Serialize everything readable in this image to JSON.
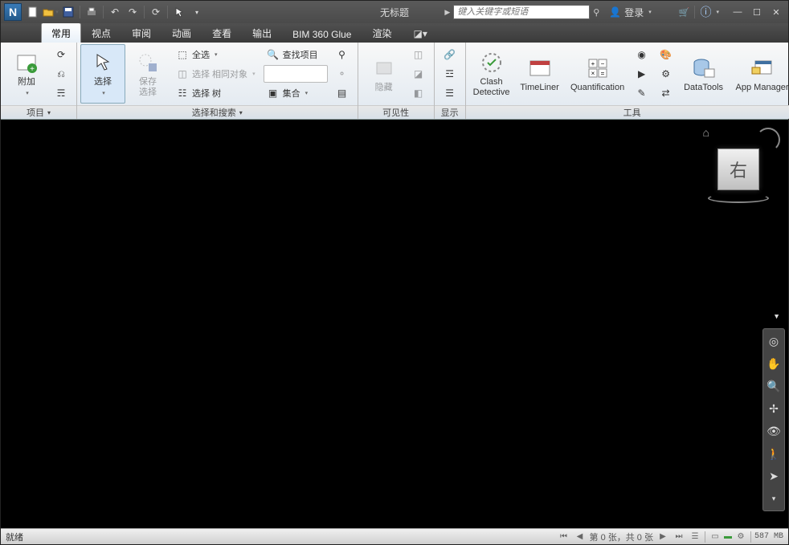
{
  "app": {
    "logo_letter": "N",
    "title": "无标题",
    "search_placeholder": "键入关键字或短语",
    "login_label": "登录"
  },
  "qat": {
    "new": "新建",
    "open": "打开",
    "save": "保存",
    "print": "打印",
    "undo": "撤销",
    "redo": "重做",
    "refresh": "刷新",
    "select": "选择"
  },
  "tabs": {
    "home": "常用",
    "viewpoint": "视点",
    "review": "审阅",
    "animation": "动画",
    "view": "查看",
    "output": "输出",
    "bim360": "BIM 360 Glue",
    "render": "渲染"
  },
  "ribbon": {
    "groups": {
      "project": "项目",
      "select_search": "选择和搜索",
      "visibility": "可见性",
      "display": "显示",
      "tools": "工具"
    },
    "project": {
      "append": "附加"
    },
    "select": {
      "select": "选择",
      "save_sel": "保存\n选择",
      "select_all": "全选",
      "select_same": "选择 相同对象",
      "selection_tree": "选择 树",
      "find_items": "查找项目",
      "sets_label": "集合"
    },
    "visibility": {
      "hide": "隐藏"
    },
    "tools": {
      "clash": "Clash\nDetective",
      "timeliner": "TimeLiner",
      "quantification": "Quantification",
      "datatools": "DataTools",
      "appmanager": "App Manager"
    }
  },
  "viewcube": {
    "face": "右"
  },
  "status": {
    "ready": "就绪",
    "sheet": "第 0 张，共 0 张",
    "memory": "587 MB"
  }
}
